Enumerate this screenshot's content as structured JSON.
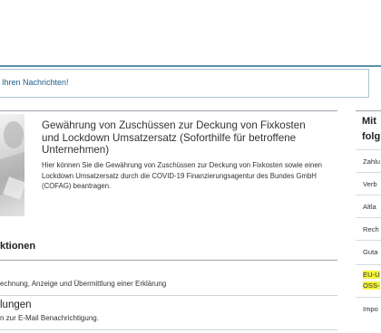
{
  "messages_bar": {
    "link_text": "Ihren Nachrichten!"
  },
  "service_card": {
    "title": "Gewährung von Zuschüssen zur Deckung von Fixkosten und Lockdown Umsatzersatz (Soforthilfe für betroffene Unternehmen)",
    "description": "Hier können Sie die Gewährung von Zuschüssen zur Deckung von Fixkosten sowie einen Lockdown Umsatzersatz durch die COVID-19 Finanzierungsagentur des Bundes GmbH (COFAG) beantragen."
  },
  "section": {
    "title": "ktionen",
    "items": [
      {
        "title": "",
        "description": "echnung, Anzeige und Übermittlung einer Erklärung"
      },
      {
        "title": "lungen",
        "description": "n zur E-Mail Benachrichtigung."
      }
    ]
  },
  "sidebar": {
    "heading_line1": "Mit",
    "heading_line2": "folg",
    "items": [
      "Zahlu",
      "Verb",
      "Altla",
      "Rech",
      "Guta"
    ],
    "highlighted": [
      "EU-U",
      "OSS-"
    ],
    "last_item": "Impo",
    "highlight_color": "#f4f43c"
  }
}
